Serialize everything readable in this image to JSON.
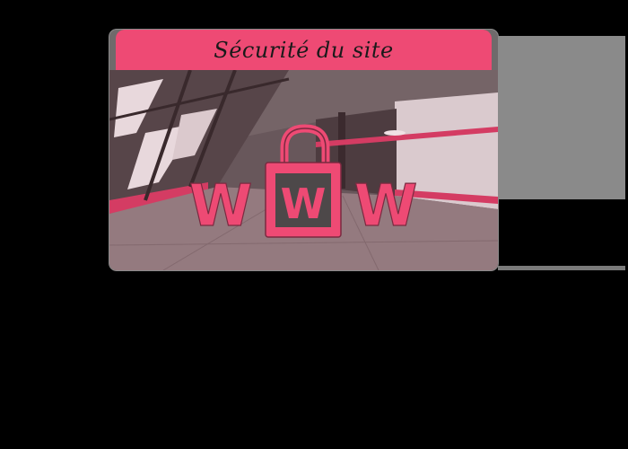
{
  "card": {
    "title": "Sécurité du site",
    "accent_color": "#ee4a74",
    "icon": "padlock-icon",
    "logo_letters": [
      "W",
      "W",
      "W"
    ]
  }
}
